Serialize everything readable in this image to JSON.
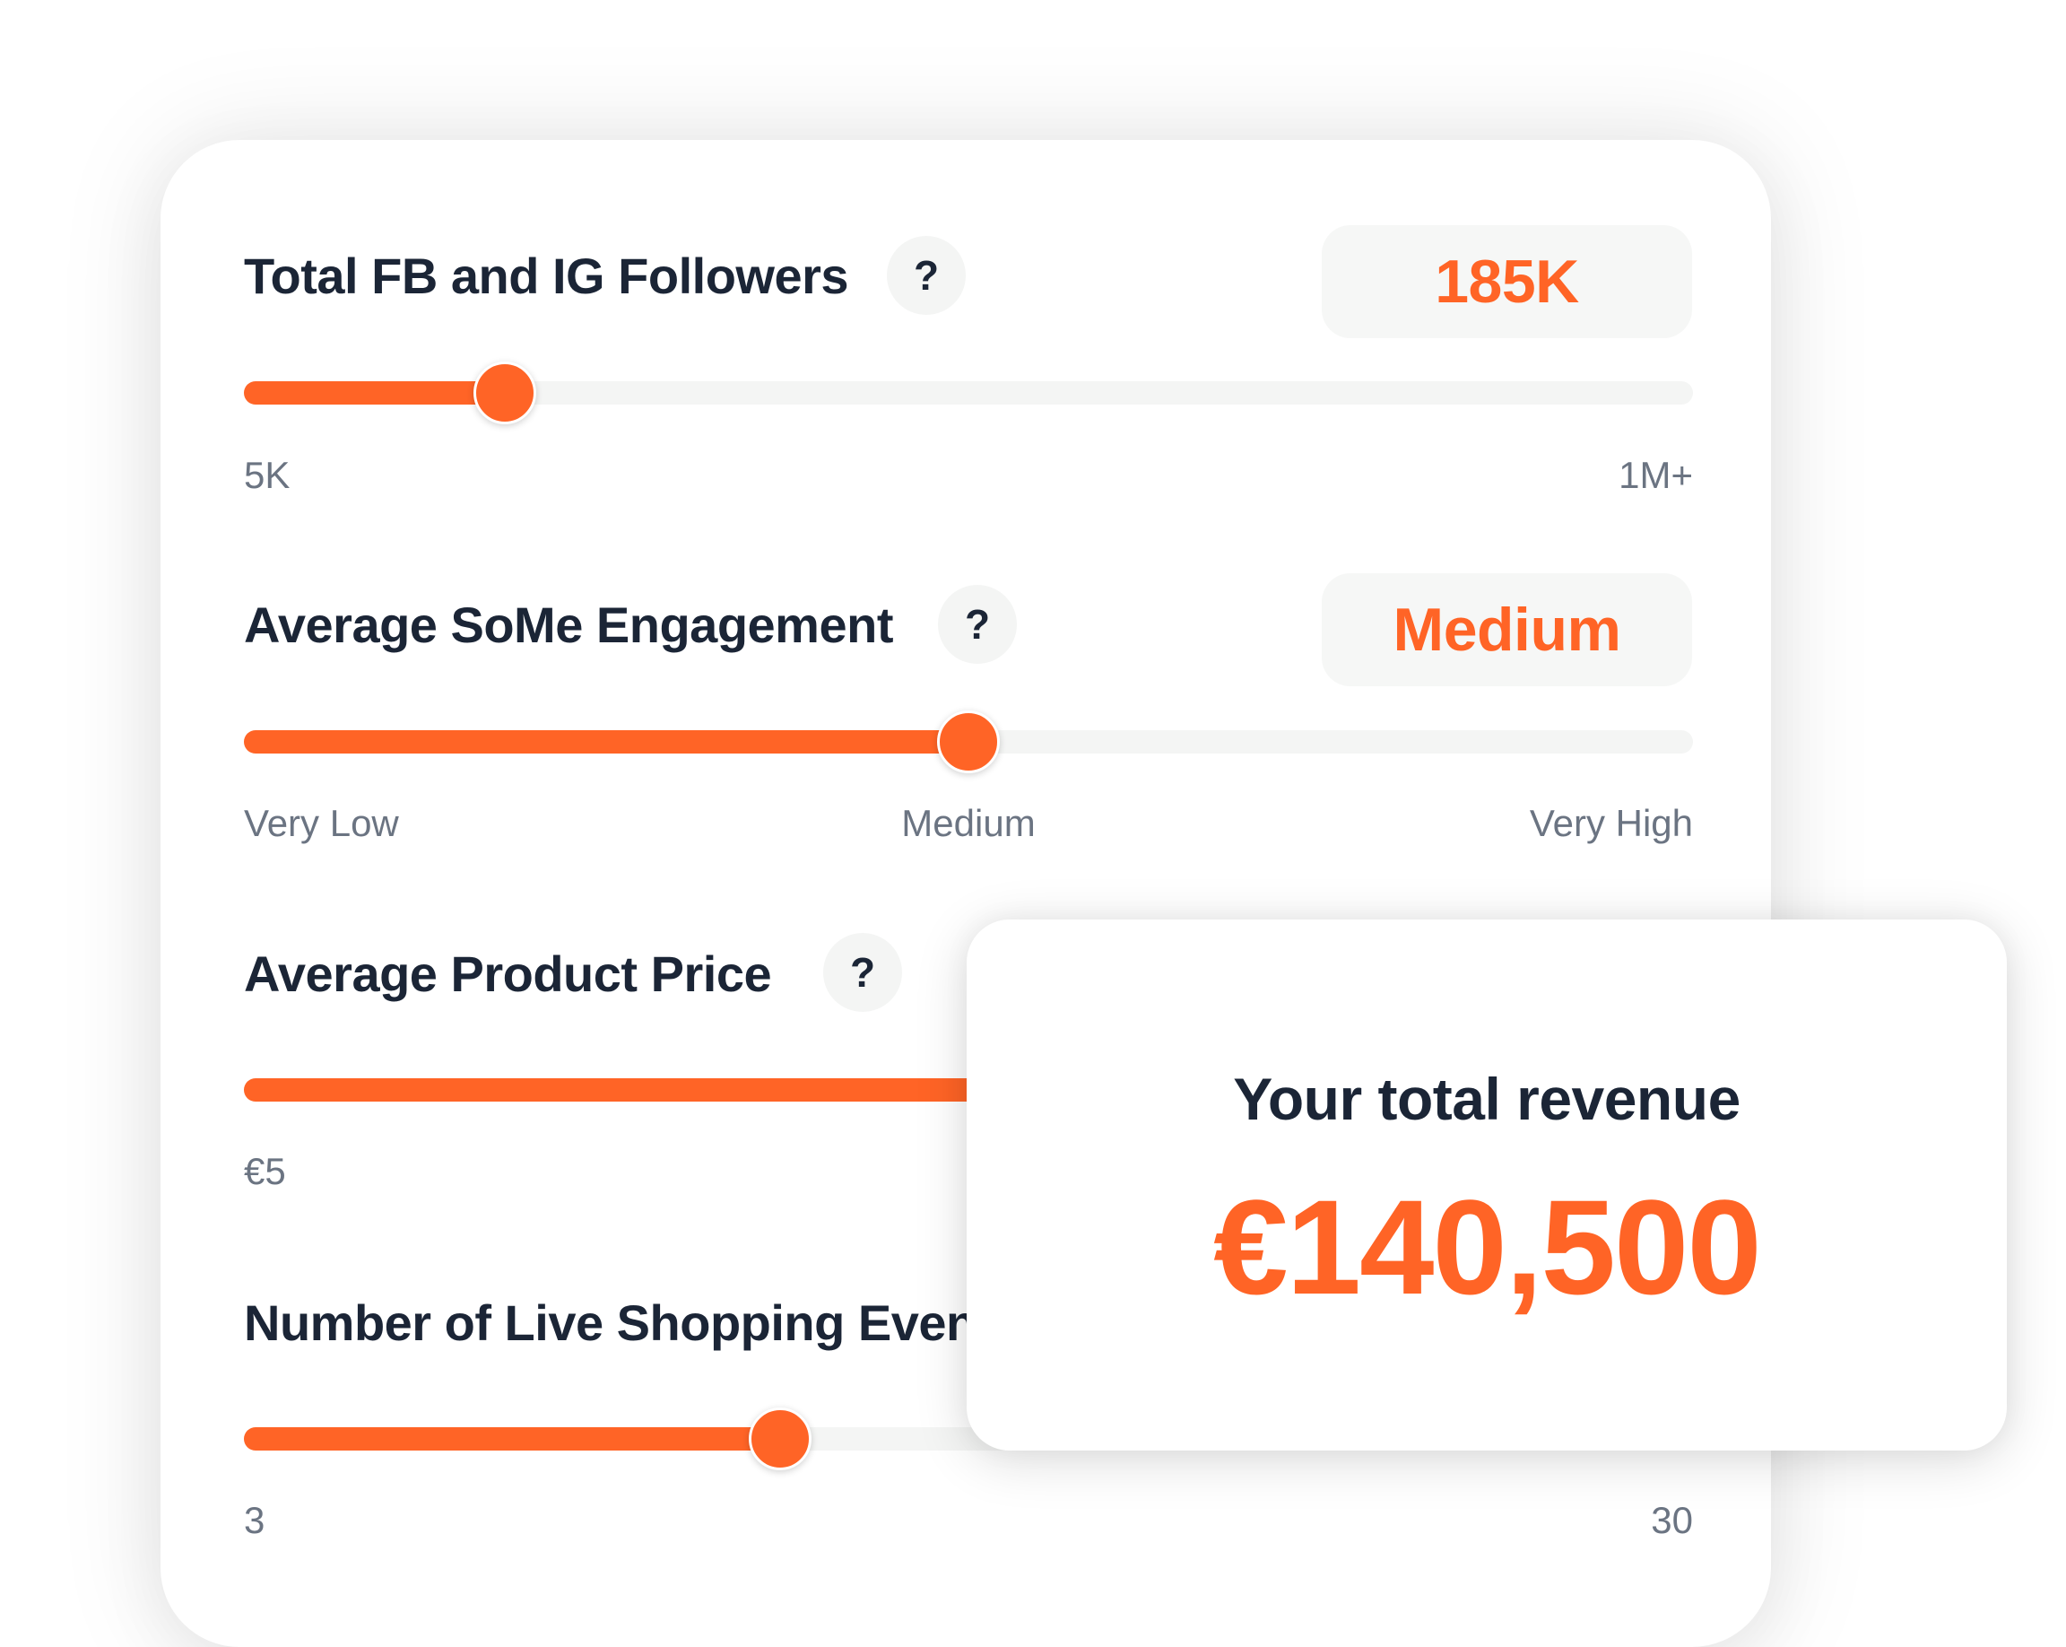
{
  "colors": {
    "accent": "#ff6426",
    "text": "#1b2536",
    "muted": "#6b7482",
    "track": "#f4f5f4"
  },
  "sliders": [
    {
      "label": "Total FB and IG Followers",
      "help_icon": "question-mark-icon",
      "value_display": "185K",
      "fraction": 0.18,
      "min_label": "5K",
      "max_label": "1M+"
    },
    {
      "label": "Average SoMe Engagement",
      "help_icon": "question-mark-icon",
      "value_display": "Medium",
      "fraction": 0.5,
      "min_label": "Very Low",
      "mid_label": "Medium",
      "max_label": "Very High"
    },
    {
      "label": "Average Product Price",
      "help_icon": "question-mark-icon",
      "min_label": "€5"
    },
    {
      "label": "Number of Live Shopping Events",
      "min_label": "3",
      "max_label": "30",
      "fraction": 0.37
    }
  ],
  "help_glyph": "?",
  "revenue": {
    "title": "Your total revenue",
    "amount": "€140,500"
  }
}
